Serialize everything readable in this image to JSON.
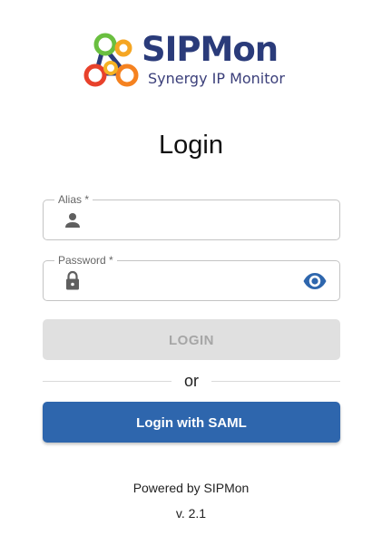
{
  "logo": {
    "title": "SIPMon",
    "subtitle": "Synergy IP Monitor",
    "icon": "network-nodes-logo-icon"
  },
  "page": {
    "title": "Login"
  },
  "form": {
    "alias": {
      "label": "Alias *",
      "value": "",
      "placeholder": "",
      "icon": "person-icon"
    },
    "password": {
      "label": "Password *",
      "value": "",
      "placeholder": "",
      "icon": "lock-icon",
      "toggle_icon": "eye-icon"
    },
    "login_label": "LOGIN",
    "divider_text": "or",
    "saml_label": "Login with SAML"
  },
  "footer": {
    "powered_by": "Powered by SIPMon",
    "version": "v. 2.1"
  },
  "colors": {
    "brand_primary": "#2e66ad",
    "logo_text": "#2a3b7a",
    "disabled_button": "#e0e0e0",
    "icon_gray": "#5f5f5f"
  }
}
